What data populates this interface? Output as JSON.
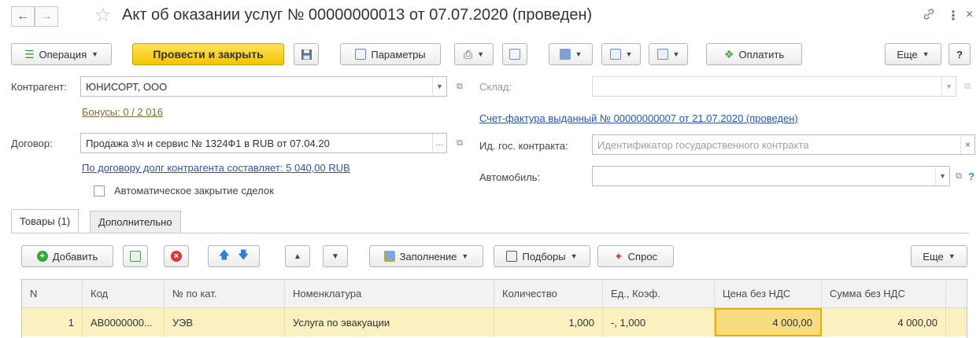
{
  "window": {
    "title": "Акт об оказании услуг № 00000000013 от 07.07.2020 (проведен)",
    "back_icon": "arrow-left-icon",
    "forward_icon": "arrow-right-icon",
    "favorite_icon": "star-icon",
    "link_icon": "link-icon",
    "more_icon": "kebab-icon",
    "close_icon": "close-icon"
  },
  "toolbar": {
    "operation_label": "Операция",
    "post_close_label": "Провести и закрыть",
    "params_label": "Параметры",
    "pay_label": "Оплатить",
    "more_label": "Еще",
    "help_label": "?"
  },
  "form": {
    "counterparty_label": "Контрагент:",
    "counterparty_value": "ЮНИСОРТ, ООО",
    "bonus_link": "Бонусы: 0 / 2 016",
    "contract_label": "Договор:",
    "contract_value": "Продажа з\\ч и сервис № 1324Ф1 в RUB от 07.04.20",
    "debt_link": "По договору долг контрагента составляет: 5 040,00 RUB",
    "auto_close_label": "Автоматическое закрытие сделок",
    "auto_close_checked": false,
    "warehouse_label": "Склад:",
    "warehouse_value": "",
    "invoice_link": "Счет-фактура выданный № 00000000007 от 21.07.2020 (проведен)",
    "gov_contract_label": "Ид. гос. контракта:",
    "gov_contract_placeholder": "Идентификатор государственного контракта",
    "car_label": "Автомобиль:",
    "car_value": ""
  },
  "tabs": [
    {
      "label": "Товары (1)",
      "active": true
    },
    {
      "label": "Дополнительно",
      "active": false
    }
  ],
  "table_toolbar": {
    "add_label": "Добавить",
    "fill_label": "Заполнение",
    "pick_label": "Подборы",
    "demand_label": "Спрос",
    "more_label": "Еще"
  },
  "table": {
    "columns": [
      "N",
      "Код",
      "№ по кат.",
      "Номенклатура",
      "Количество",
      "Ед., Коэф.",
      "Цена без НДС",
      "Сумма без НДС"
    ],
    "rows": [
      [
        "1",
        "АВ0000000...",
        "УЭВ",
        "Услуга по эвакуации",
        "1,000",
        "-, 1,000",
        "4 000,00",
        "4 000,00"
      ]
    ]
  },
  "colors": {
    "primary_button": "#f3c500",
    "selected_row": "#fbf0c0",
    "selected_cell": "#f7dc82",
    "link": "#2a56a8"
  }
}
